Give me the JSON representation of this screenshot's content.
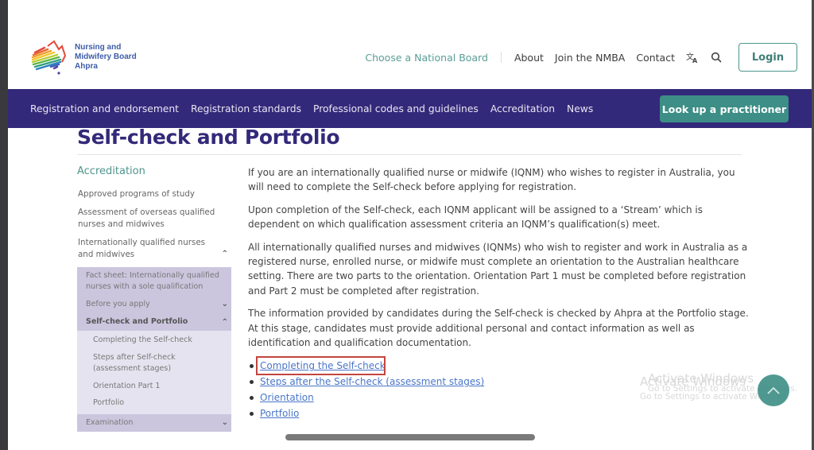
{
  "site": {
    "logo": {
      "line1": "Nursing and",
      "line2": "Midwifery Board",
      "line3": "Ahpra"
    }
  },
  "top_nav": {
    "choose_board": "Choose a National Board",
    "links": [
      "About",
      "Join the NMBA",
      "Contact"
    ],
    "translate_icon": "translate-icon",
    "search_icon": "search-icon",
    "login_label": "Login"
  },
  "main_nav": {
    "items": [
      "Registration and endorsement",
      "Registration standards",
      "Professional codes and guidelines",
      "Accreditation",
      "News"
    ],
    "lookup_label": "Look up a practitioner"
  },
  "page": {
    "title": "Self-check and Portfolio"
  },
  "sidebar": {
    "heading": "Accreditation",
    "items": [
      "Approved programs of study",
      "Assessment of overseas qualified nurses and midwives",
      "Internationally qualified nurses and midwives"
    ],
    "sub_items": [
      "Fact sheet: Internationally qualified nurses with a sole qualification",
      "Before you apply",
      "Self-check and Portfolio"
    ],
    "subsub_items": [
      "Completing the Self-check",
      "Steps after Self-check (assessment stages)",
      "Orientation Part 1",
      "Portfolio"
    ],
    "next_item": "Examination"
  },
  "content": {
    "paragraphs": [
      "If you are an internationally qualified nurse or midwife (IQNM) who wishes to register in Australia, you will need to complete the Self-check before applying for registration.",
      "Upon completion of the Self-check, each IQNM applicant will be assigned to a ‘Stream’ which is dependent on which qualification assessment criteria an IQNM’s qualification(s) meet.",
      "All internationally qualified nurses and midwives (IQNMs) who wish to register and work in Australia as a registered nurse, enrolled nurse, or midwife must complete an orientation to the Australian healthcare setting. There are two parts to the orientation. Orientation Part 1 must be completed before registration and Part 2 must be completed after registration.",
      "The information provided by candidates during the Self-check is checked by Ahpra at the Portfolio stage. At this stage, candidates must provide additional personal and contact information as well as identification and qualification documentation."
    ],
    "links": [
      "Completing the Self-check",
      "Steps after the Self-check (assessment stages)",
      "Orientation",
      "Portfolio"
    ]
  },
  "watermark": {
    "title": "Activate Windows",
    "subtitle": "Go to Settings to activate Windows."
  },
  "colors": {
    "brand_purple": "#33297a",
    "brand_teal": "#3d8e86",
    "link_blue": "#4a76c8",
    "highlight_red": "#c3453e"
  }
}
